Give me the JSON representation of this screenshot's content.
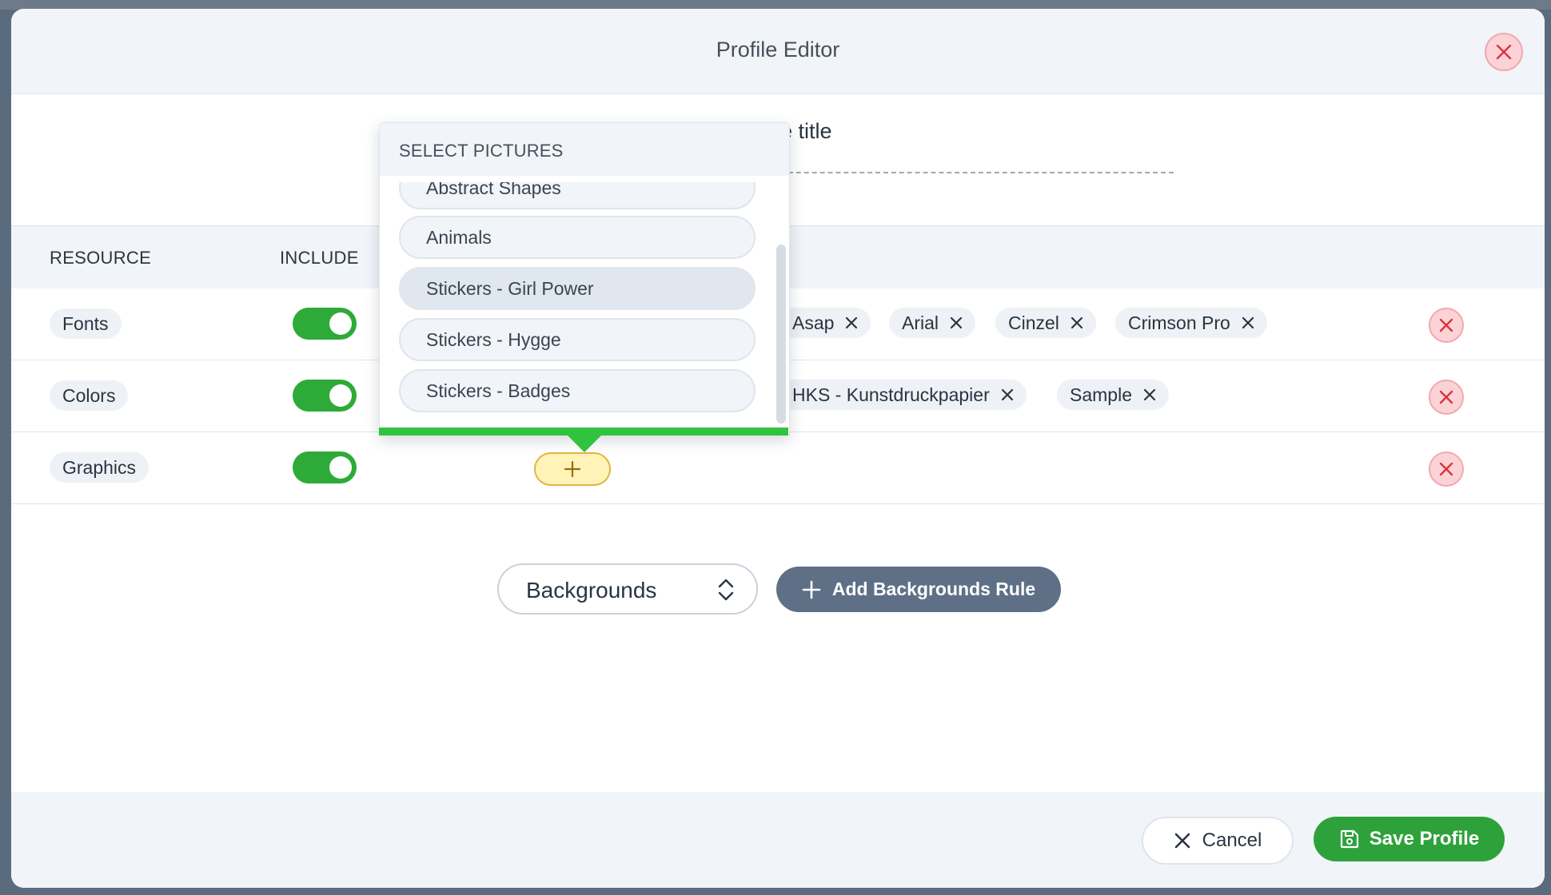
{
  "dialog": {
    "title": "Profile Editor",
    "title_field_text": "e title"
  },
  "table": {
    "headers": {
      "resource": "RESOURCE",
      "include": "INCLUDE"
    },
    "rows": [
      {
        "resource": "Fonts",
        "include": true,
        "tags": [
          "Asap",
          "Arial",
          "Cinzel",
          "Crimson Pro"
        ]
      },
      {
        "resource": "Colors",
        "include": true,
        "tags": [
          "HKS - Kunstdruckpapier",
          "Sample"
        ]
      },
      {
        "resource": "Graphics",
        "include": true,
        "tags": []
      }
    ]
  },
  "picker": {
    "header": "SELECT PICTURES",
    "options": [
      "Abstract Shapes",
      "Animals",
      "Stickers - Girl Power",
      "Stickers - Hygge",
      "Stickers - Badges"
    ],
    "highlighted": "Stickers - Girl Power"
  },
  "add_rule": {
    "selected_resource": "Backgrounds",
    "button_label": "Add Backgrounds Rule"
  },
  "footer": {
    "cancel_label": "Cancel",
    "save_label": "Save Profile"
  },
  "colors": {
    "toggle_on": "#2eaa38",
    "save": "#2ea23a",
    "danger_bg": "#fbd3d6",
    "danger_icon": "#d9343f",
    "add_pill": "#fff3b8",
    "accent_bar": "#33c23f"
  }
}
